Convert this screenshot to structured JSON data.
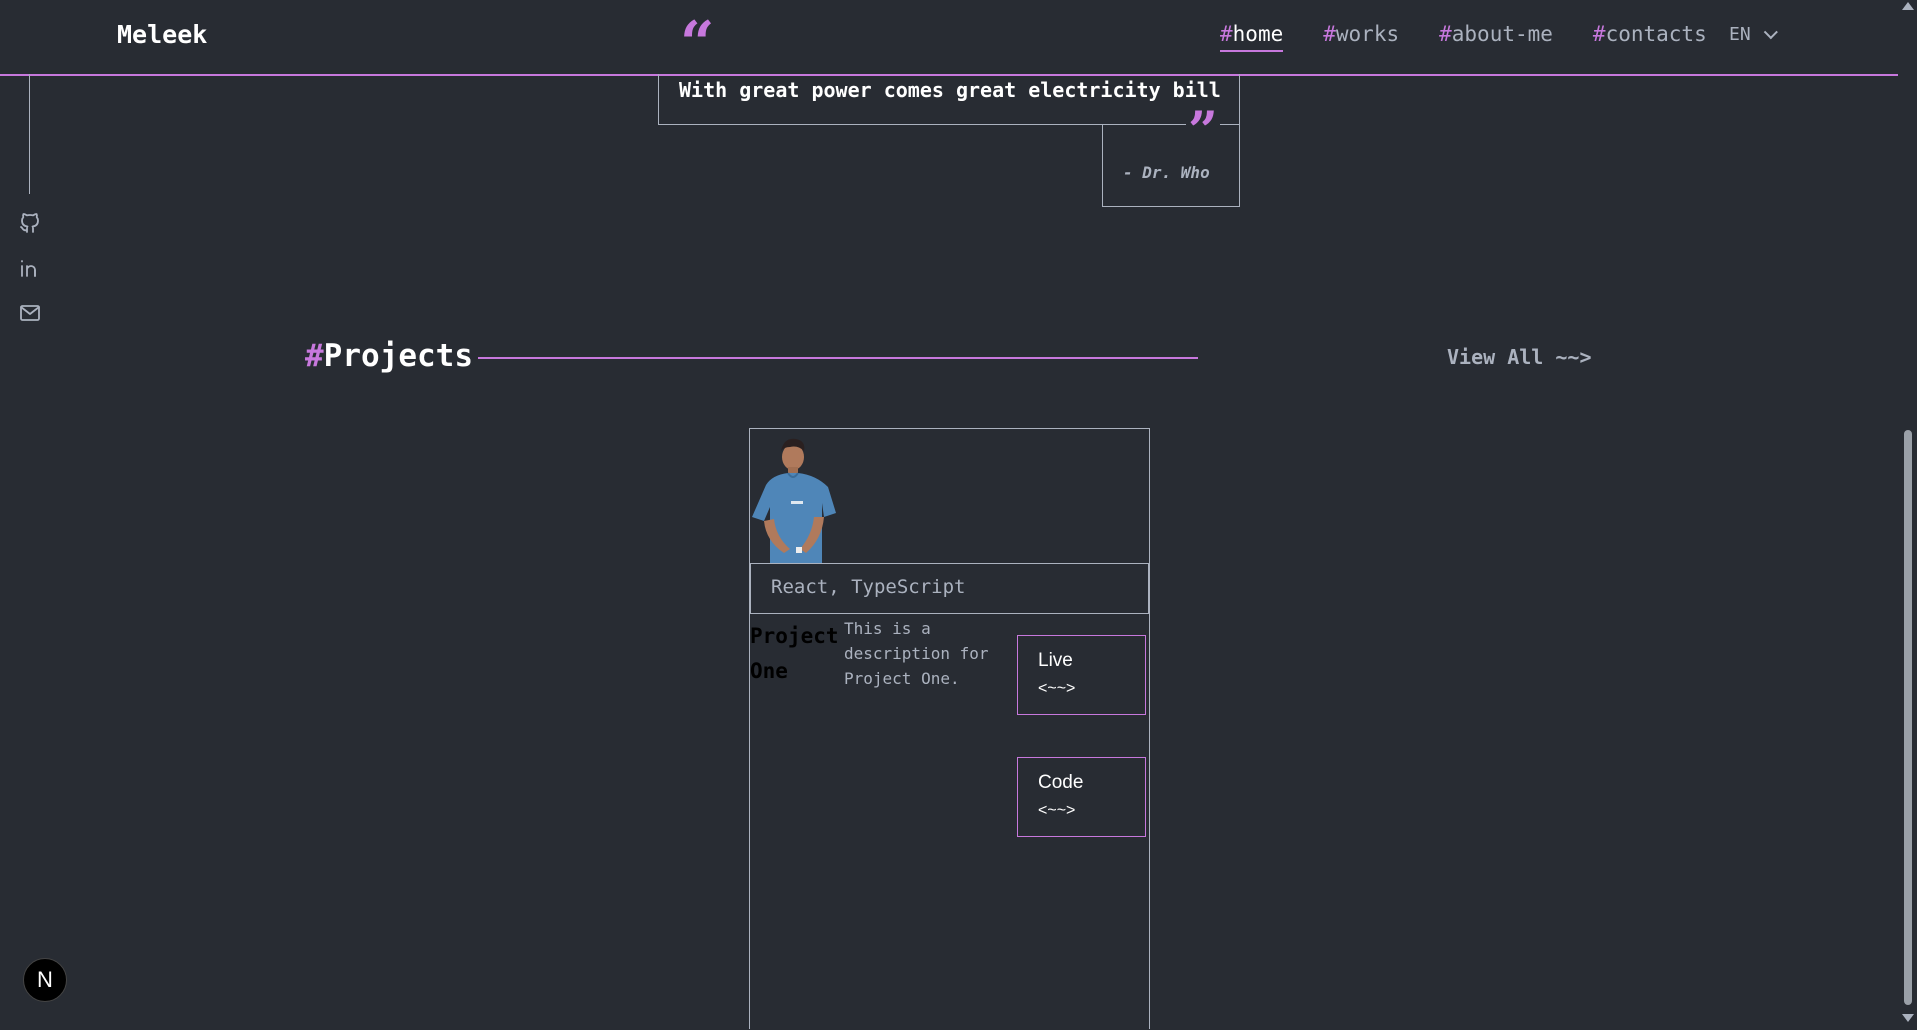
{
  "header": {
    "logo": "Meleek",
    "nav": [
      {
        "hash": "#",
        "label": "home",
        "active": true
      },
      {
        "hash": "#",
        "label": "works"
      },
      {
        "hash": "#",
        "label": "about-me"
      },
      {
        "hash": "#",
        "label": "contacts"
      }
    ],
    "language": "EN"
  },
  "quote": {
    "open_mark": "“",
    "text": "With great power comes great electricity bill",
    "close_mark": "”",
    "author": "- Dr. Who"
  },
  "social": [
    {
      "icon": "github-icon"
    },
    {
      "icon": "linkedin-icon"
    },
    {
      "icon": "email-icon"
    }
  ],
  "projects": {
    "hash": "#",
    "title": "Projects",
    "view_all": "View All ~~>",
    "cards": [
      {
        "image": "person-photo",
        "tech": "React, TypeScript",
        "name": "Project One",
        "description": "This is a description for Project One.",
        "live_label": "Live",
        "live_arrow": "<~~>",
        "code_label": "Code",
        "code_arrow": "<~~>"
      }
    ]
  },
  "badge": "N",
  "colors": {
    "background": "#282c33",
    "accent": "#c778dd",
    "text": "#abb2bf",
    "white": "#ffffff"
  }
}
